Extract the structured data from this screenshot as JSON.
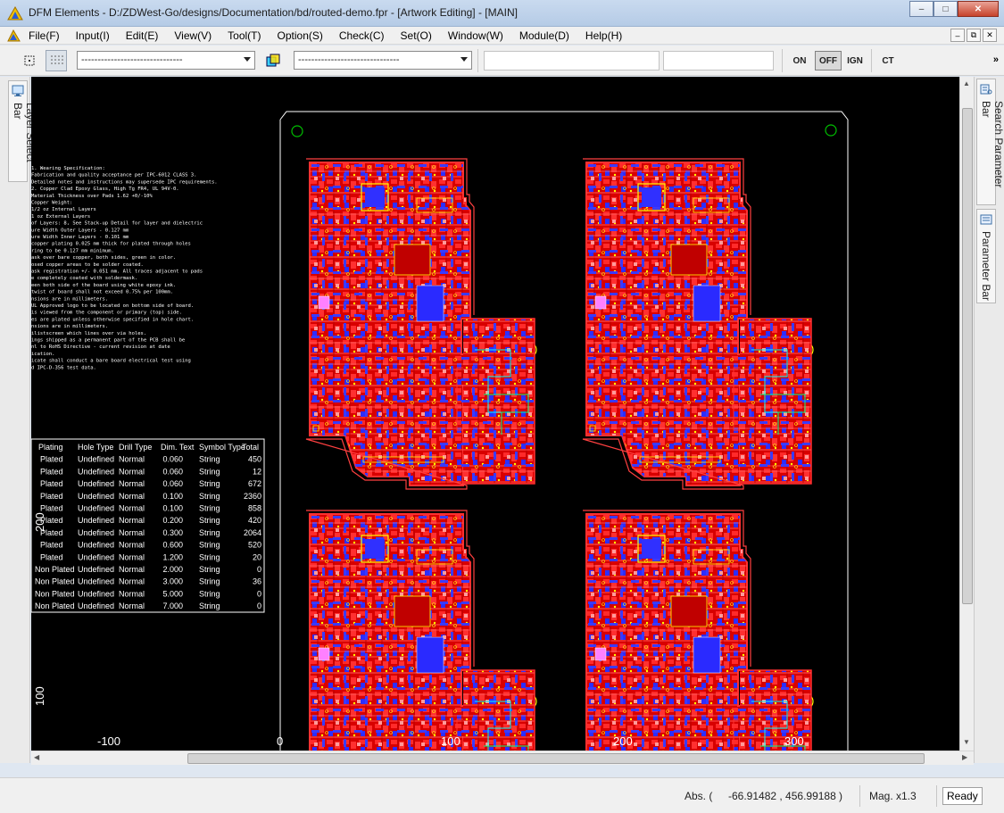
{
  "window": {
    "title": "DFM Elements - D:/ZDWest-Go/designs/Documentation/bd/routed-demo.fpr - [Artwork Editing] - [MAIN]",
    "minimize": "–",
    "maximize": "□",
    "close": "✕"
  },
  "menu": {
    "items": [
      "File(F)",
      "Input(I)",
      "Edit(E)",
      "View(V)",
      "Tool(T)",
      "Option(S)",
      "Check(C)",
      "Set(O)",
      "Window(W)",
      "Module(D)",
      "Help(H)"
    ],
    "mdi": [
      "–",
      "⧉",
      "✕"
    ]
  },
  "toolbar": {
    "combo1": "-------------------------------",
    "combo2": "-------------------------------",
    "field1": "",
    "field2": "",
    "state_on": "ON",
    "state_off": "OFF",
    "state_ign": "IGN",
    "state_ct": "CT",
    "overflow": "»"
  },
  "docks": {
    "left_tab": "Layer Select Bar",
    "right_tab1": "Search Parameter Bar",
    "right_tab2": "Parameter Bar"
  },
  "canvas": {
    "ruler_x": [
      "-100",
      "0",
      "100",
      "200",
      "300"
    ],
    "ruler_y": [
      "200",
      "100"
    ],
    "notes": [
      "1. Wearing Specification:",
      "   Fabrication and quality acceptance per IPC-6012 CLASS 3.",
      "   Detailed notes and instructions may supersede IPC requirements.",
      "2. Copper Clad Epoxy Glass, High Tg FR4, UL 94V-0.",
      "   Material Thickness over Pads 1.62 +0/-10%",
      "   Copper Weight:",
      "   1/2 oz Internal Layers",
      "   1 oz External Layers",
      "   of Layers: 8, See Stack-up Detail for layer and dielectric",
      "   ure Width Outer Layers - 0.127 mm",
      "   ure Width Inner Layers - 0.101 mm",
      "   copper plating 0.025 mm thick for plated through holes",
      "   ring to be 0.127 mm minimum.",
      "   ask over bare copper, both sides, green in color.",
      "   osed copper areas to be solder coated.",
      "   ask registration +/- 0.051 mm. All traces adjacent to pads",
      "   e completely coated with soldermask.",
      "   een both side of the board using white epoxy ink.",
      "   twist of board shall not exceed 0.75% per 100mm.",
      "   nsions are in millimeters.",
      "   UL Approved logo to be located on bottom side of board.",
      "   is viewed from the component or primary (top) side.",
      "   es are plated unless otherwise specified in hole chart.",
      "   nsions are in millimeters.",
      "   ilistscreen which lines over via holes.",
      "   ings shipped as a permanent part of the PCB shall be",
      "   nl to RoHS Directive - current revision at date",
      "   ication.",
      "   icate shall conduct a bare board electrical test using",
      "   d IPC-D-356 test data."
    ],
    "drill_table": {
      "headers": [
        "Plating",
        "Hole Type",
        "Drill Type",
        "Dim. Text",
        "Symbol Type",
        "Total"
      ],
      "rows": [
        [
          "Plated",
          "Undefined",
          "Normal",
          "0.060",
          "String",
          "450"
        ],
        [
          "Plated",
          "Undefined",
          "Normal",
          "0.060",
          "String",
          "12"
        ],
        [
          "Plated",
          "Undefined",
          "Normal",
          "0.060",
          "String",
          "672"
        ],
        [
          "Plated",
          "Undefined",
          "Normal",
          "0.100",
          "String",
          "2360"
        ],
        [
          "Plated",
          "Undefined",
          "Normal",
          "0.100",
          "String",
          "858"
        ],
        [
          "Plated",
          "Undefined",
          "Normal",
          "0.200",
          "String",
          "420"
        ],
        [
          "Plated",
          "Undefined",
          "Normal",
          "0.300",
          "String",
          "2064"
        ],
        [
          "Plated",
          "Undefined",
          "Normal",
          "0.600",
          "String",
          "520"
        ],
        [
          "Plated",
          "Undefined",
          "Normal",
          "1.200",
          "String",
          "20"
        ],
        [
          "Non Plated",
          "Undefined",
          "Normal",
          "2.000",
          "String",
          "0"
        ],
        [
          "Non Plated",
          "Undefined",
          "Normal",
          "3.000",
          "String",
          "36"
        ],
        [
          "Non Plated",
          "Undefined",
          "Normal",
          "5.000",
          "String",
          "0"
        ],
        [
          "Non Plated",
          "Undefined",
          "Normal",
          "7.000",
          "String",
          "0"
        ]
      ]
    }
  },
  "status": {
    "abs_label": "Abs. (",
    "abs_value": "-66.91482 , 456.99188",
    "abs_close": ")",
    "mag": "Mag. x1.3",
    "state": "Ready"
  },
  "colors": {
    "canvas_bg": "#000000",
    "copper_top": "#ff1a1a",
    "copper_inner": "#3a3aff",
    "silkscreen": "#ffff00",
    "outline": "#ffffff",
    "fiducial": "#00c000"
  }
}
